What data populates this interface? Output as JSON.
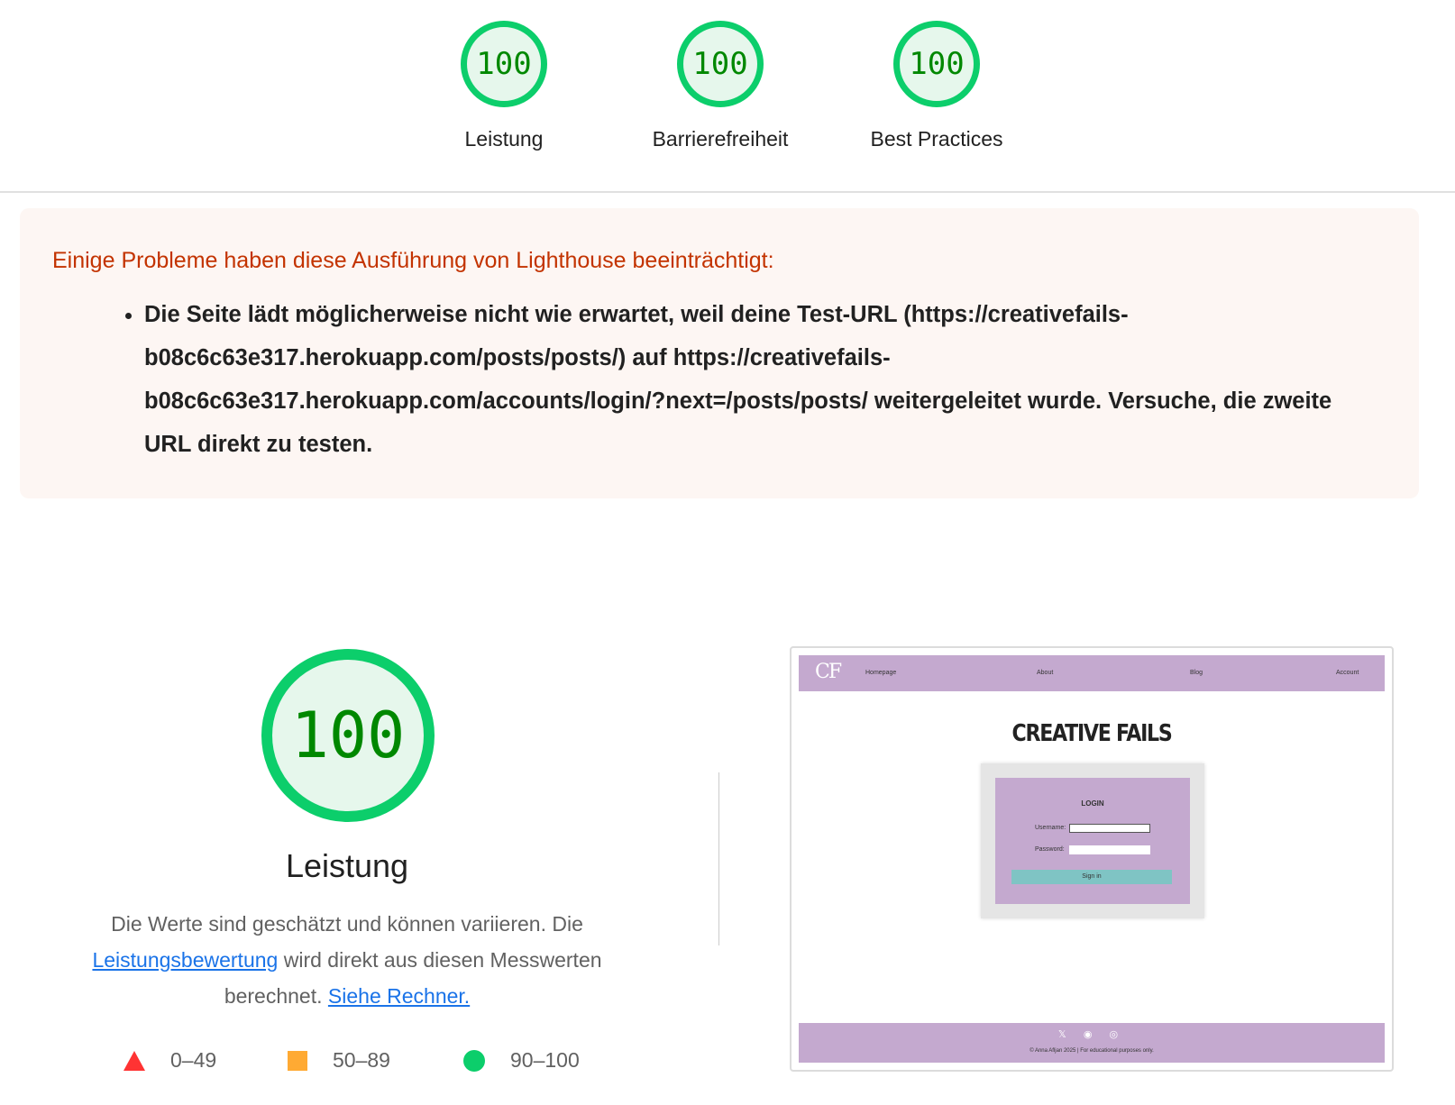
{
  "summary": {
    "gauges": [
      {
        "score": "100",
        "label": "Leistung"
      },
      {
        "score": "100",
        "label": "Barrierefreiheit"
      },
      {
        "score": "100",
        "label": "Best Practices"
      }
    ],
    "score_color": "#0cce6b"
  },
  "warning": {
    "title": "Einige Probleme haben diese Ausführung von Lighthouse beeinträchtigt:",
    "items": [
      "Die Seite lädt möglicherweise nicht wie erwartet, weil deine Test-URL (https://creativefails-b08c6c63e317.herokuapp.com/posts/posts/) auf https://creativefails-b08c6c63e317.herokuapp.com/accounts/login/?next=/posts/posts/ weitergeleitet wurde. Versuche, die zweite URL direkt zu testen."
    ]
  },
  "performance": {
    "score": "100",
    "label": "Leistung",
    "desc_part1": "Die Werte sind geschätzt und können variieren. Die ",
    "desc_link1": "Leistungsbewertung",
    "desc_part2": " wird direkt aus diesen Messwerten berechnet. ",
    "desc_link2": "Siehe Rechner."
  },
  "legend": {
    "fail": "0–49",
    "average": "50–89",
    "pass": "90–100",
    "colors": {
      "fail": "#ff3333",
      "average": "#ffaa33",
      "pass": "#0cce6b"
    }
  },
  "thumbnail": {
    "logo": "CF",
    "nav": [
      "Homepage",
      "About",
      "Blog",
      "Account"
    ],
    "brand": "CREATIVE FAILS",
    "login_title": "LOGIN",
    "username_label": "Username:",
    "password_label": "Password:",
    "signin": "Sign in",
    "footer_icons": "𝕏 ◉ ◎",
    "footer_text": "© Anna Afljan 2025 | For educational purposes only."
  }
}
